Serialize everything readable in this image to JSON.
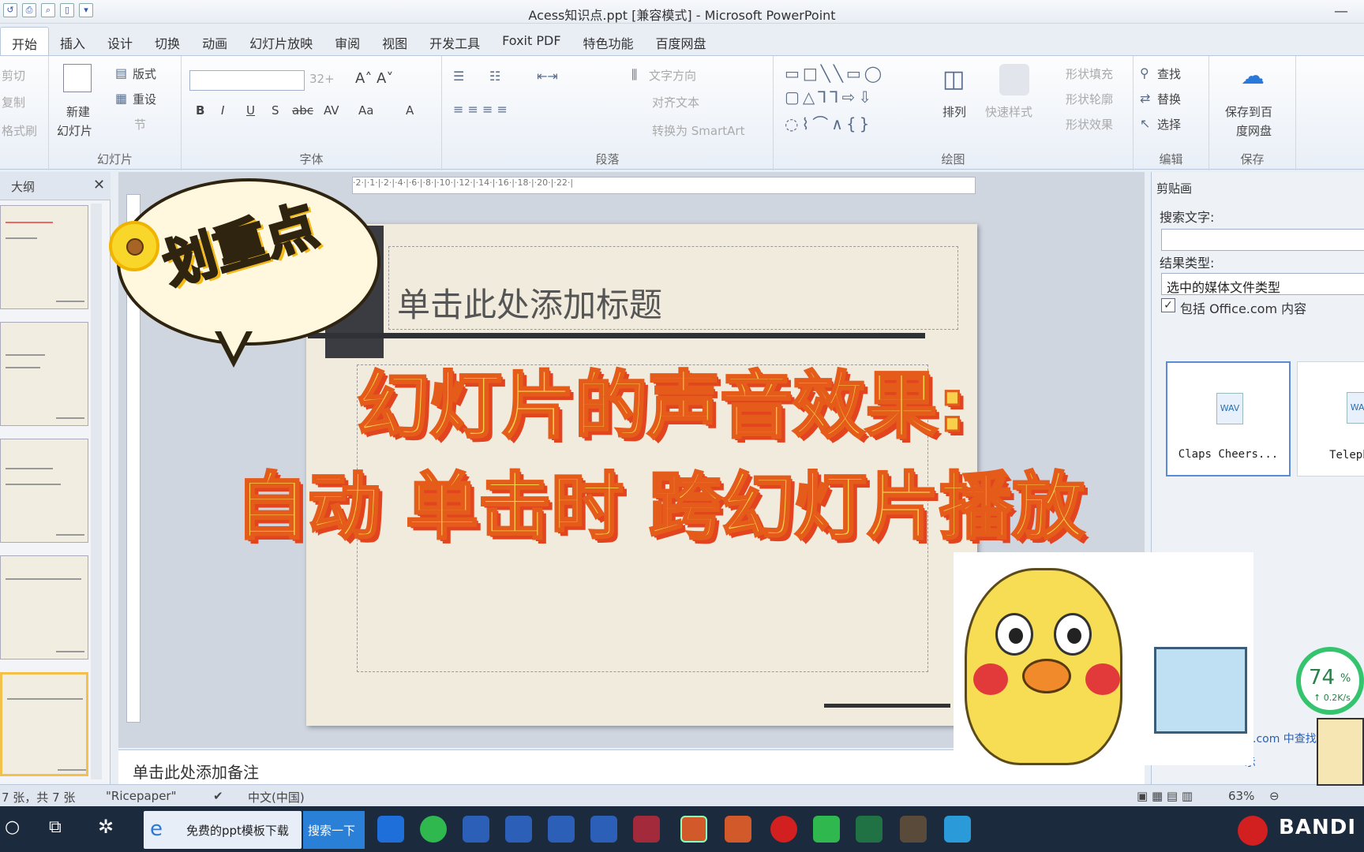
{
  "window": {
    "title": "Acess知识点.ppt [兼容模式] - Microsoft PowerPoint",
    "minimize_glyph": "—"
  },
  "qat_icons": [
    "undo-icon",
    "print-icon",
    "preview-icon",
    "new-icon",
    "customize-icon"
  ],
  "tabs": [
    "开始",
    "插入",
    "设计",
    "切换",
    "动画",
    "幻灯片放映",
    "审阅",
    "视图",
    "开发工具",
    "Foxit PDF",
    "特色功能",
    "百度网盘"
  ],
  "ribbon": {
    "clipboard": {
      "cut": "剪切",
      "copy": "复制",
      "painter": "格式刷"
    },
    "slides": {
      "new_slide": "新建",
      "new_slide2": "幻灯片",
      "layout": "版式",
      "reset": "重设",
      "section": "节",
      "label": "幻灯片"
    },
    "font": {
      "size": "32+",
      "label": "字体",
      "bold": "B",
      "italic": "I",
      "underline": "U",
      "shadow": "S",
      "strike": "abc",
      "spacing": "AV",
      "case": "Aa",
      "color": "A"
    },
    "paragraph": {
      "text_dir": "文字方向",
      "align_text": "对齐文本",
      "smartart": "转换为 SmartArt",
      "label": "段落"
    },
    "drawing": {
      "arrange": "排列",
      "quick_styles": "快速样式",
      "fill": "形状填充",
      "outline": "形状轮廓",
      "effects": "形状效果",
      "label": "绘图"
    },
    "editing": {
      "find": "查找",
      "replace": "替换",
      "select": "选择",
      "label": "编辑"
    },
    "save": {
      "save_to": "保存到百",
      "save_to2": "度网盘",
      "label": "保存"
    }
  },
  "left_pane": {
    "title": "大纲",
    "close": "✕"
  },
  "slide": {
    "title_placeholder": "单击此处添加标题",
    "notes_placeholder": "单击此处添加备注"
  },
  "overlay": {
    "bubble": "划重点",
    "line1": "幻灯片的声音效果:",
    "line2": "自动  单击时  跨幻灯片播放"
  },
  "clip_pane": {
    "title": "剪贴画",
    "search_label": "搜索文字:",
    "search_value": "",
    "result_label": "结果类型:",
    "result_value": "选中的媒体文件类型",
    "include": "包括 Office.com 内容",
    "include_checked": true,
    "items": [
      "Claps Cheers...",
      "Telephone"
    ],
    "badge": "WAV",
    "link1": ".com 中查找",
    "link2": "示"
  },
  "status": {
    "slide_count": "7 张，共 7 张",
    "theme": "\"Ricepaper\"",
    "lang": "中文(中国)",
    "zoom": "63%"
  },
  "gauge": {
    "value": "74",
    "unit": "%",
    "speed": "↑ 0.2K/s"
  },
  "taskbar": {
    "ie_text": "免费的ppt模板下载",
    "search": "搜索一下",
    "bandi": "BANDI",
    "apps": [
      "edge-icon",
      "browser-icon",
      "word-icon",
      "word-icon",
      "word-icon",
      "word-icon",
      "access-icon",
      "powerpoint-icon",
      "powerpoint-icon",
      "record-icon",
      "wechat-icon",
      "excel-icon",
      "app-icon",
      "search-app-icon"
    ]
  },
  "colors": {
    "accent_yellow": "#f9cf4c",
    "accent_red": "#e1441f",
    "ribbon_border": "#b9c7dc"
  }
}
